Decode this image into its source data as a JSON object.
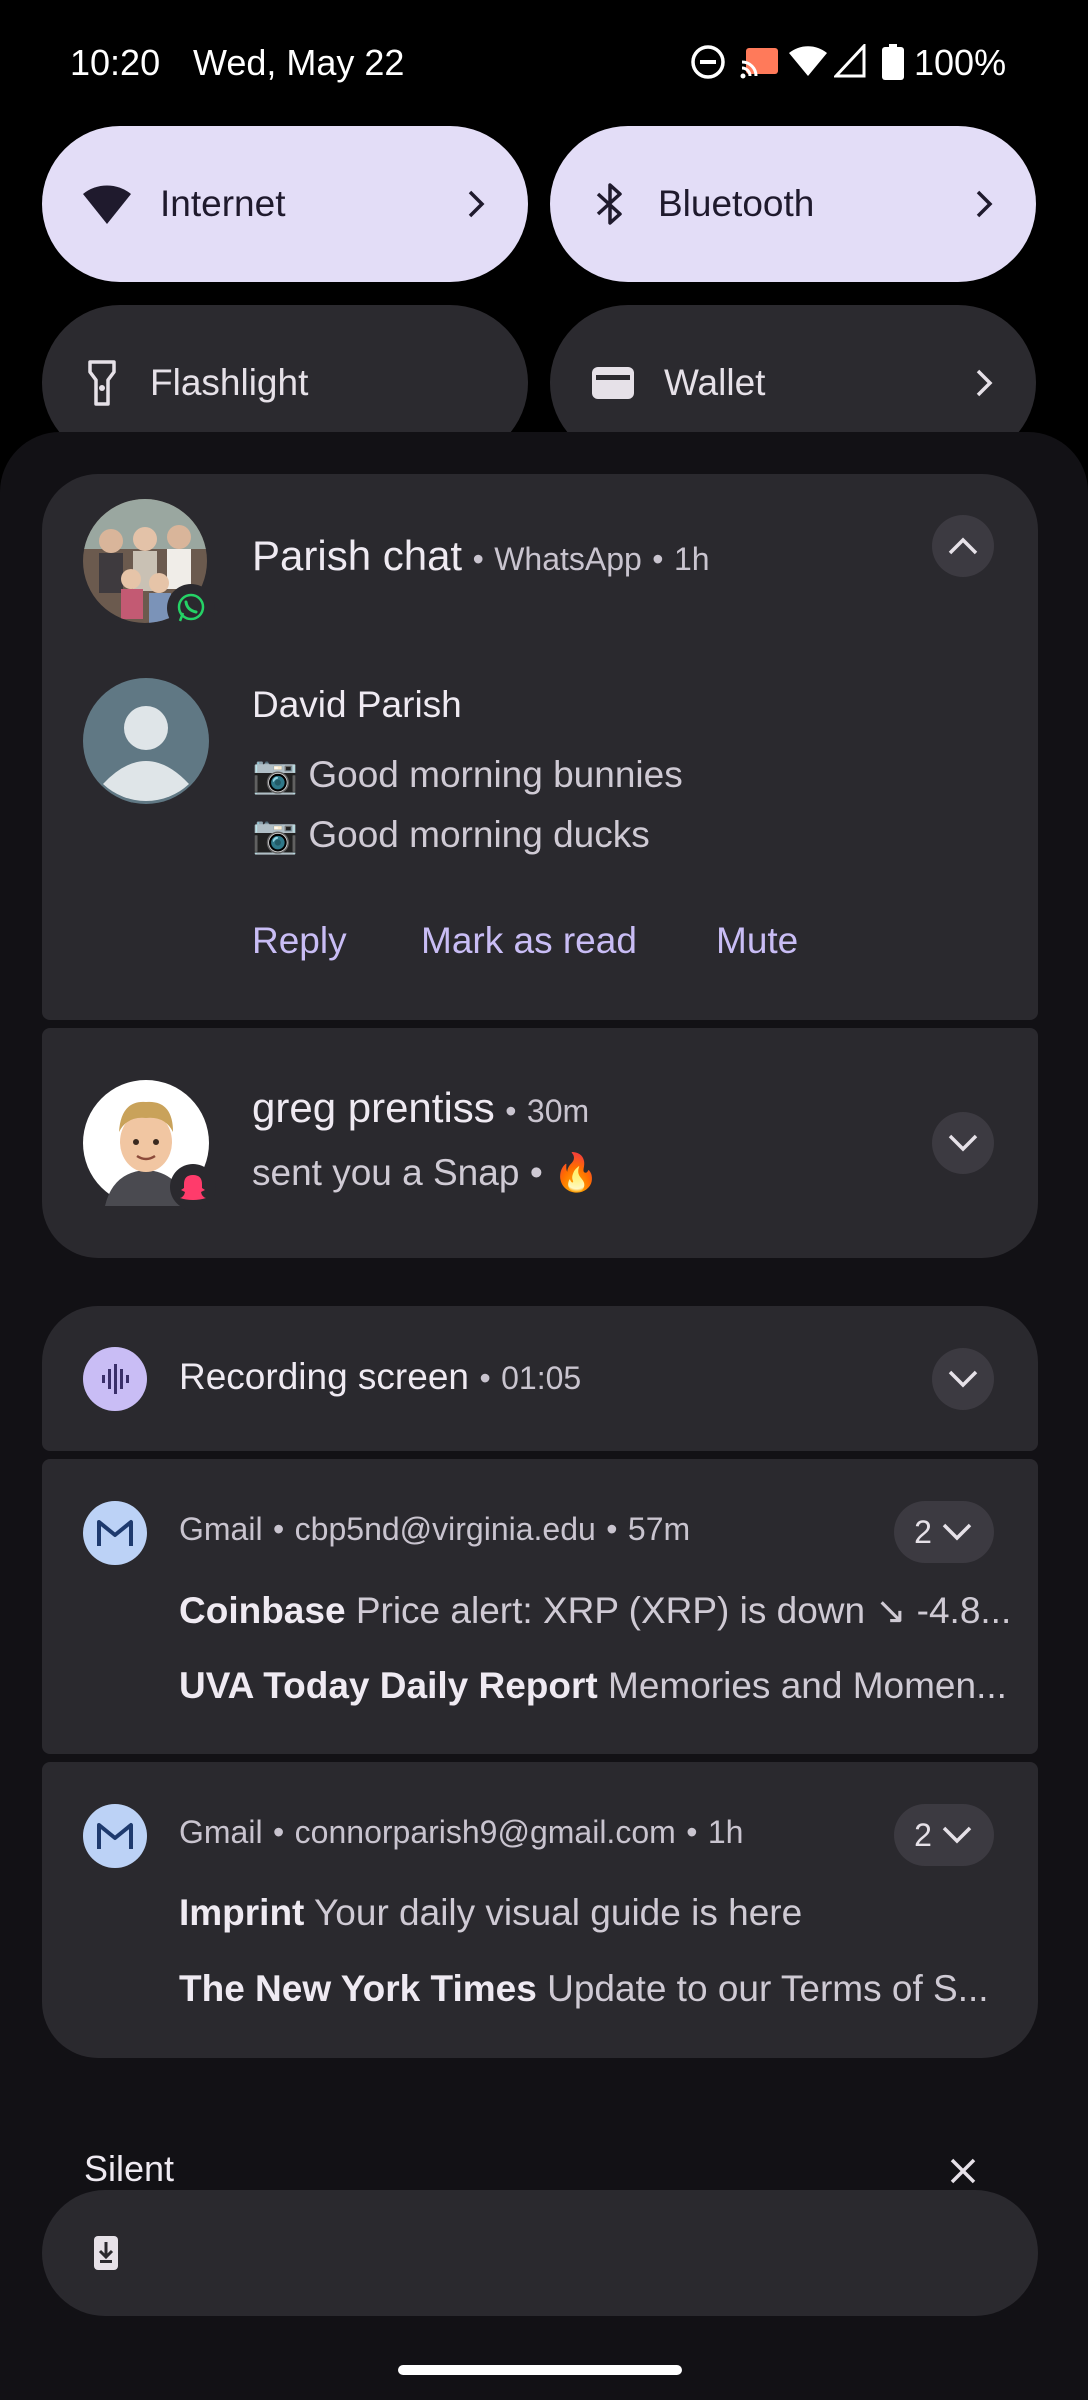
{
  "status_bar": {
    "time": "10:20",
    "date": "Wed, May 22",
    "battery": "100%",
    "icons": [
      "dnd-icon",
      "cast-icon",
      "wifi-icon",
      "signal-icon",
      "battery-icon"
    ]
  },
  "quick_settings": {
    "tiles": [
      {
        "label": "Internet",
        "icon": "wifi-icon",
        "active": true
      },
      {
        "label": "Bluetooth",
        "icon": "bluetooth-icon",
        "active": true
      },
      {
        "label": "Flashlight",
        "icon": "flashlight-icon",
        "active": false
      },
      {
        "label": "Wallet",
        "icon": "wallet-icon",
        "active": false
      }
    ]
  },
  "notifications": {
    "whatsapp": {
      "title": "Parish chat",
      "app": "WhatsApp",
      "time": "1h",
      "sender": "David Parish",
      "messages": [
        "📷 Good morning bunnies",
        "📷 Good morning ducks"
      ],
      "actions": [
        "Reply",
        "Mark as read",
        "Mute"
      ]
    },
    "snapchat": {
      "title": "greg prentiss",
      "time": "30m",
      "text": "sent you a Snap",
      "emoji": "🔥"
    },
    "recording": {
      "title": "Recording screen",
      "time": "01:05"
    },
    "gmail1": {
      "app": "Gmail",
      "account": "cbp5nd@virginia.edu",
      "time": "57m",
      "count": "2",
      "lines": [
        {
          "sender": "Coinbase",
          "text": "Price alert: XRP (XRP) is down ↘ -4.8..."
        },
        {
          "sender": "UVA Today Daily Report",
          "text": "Memories and Momen..."
        }
      ]
    },
    "gmail2": {
      "app": "Gmail",
      "account": "connorparish9@gmail.com",
      "time": "1h",
      "count": "2",
      "lines": [
        {
          "sender": "Imprint",
          "text": "Your daily visual guide is here"
        },
        {
          "sender": "The New York Times",
          "text": "Update to our Terms of S..."
        }
      ]
    }
  },
  "silent_section": {
    "label": "Silent"
  },
  "separator": "•",
  "colors": {
    "accent": "#c9bdf5",
    "tile_active": "#e3ddf7",
    "card": "#2a292e",
    "whatsapp_green": "#25d366",
    "snap_pink": "#ff3b6b"
  }
}
